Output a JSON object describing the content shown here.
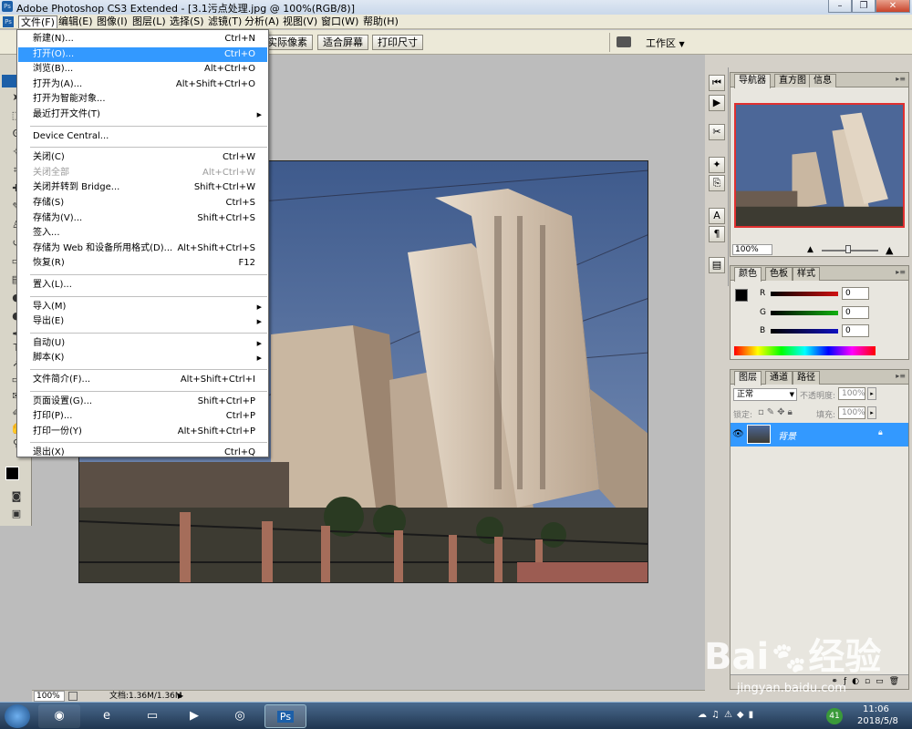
{
  "window": {
    "title": "Adobe Photoshop CS3 Extended - [3.1污点处理.jpg @ 100%(RGB/8)]",
    "app_icon": "Ps",
    "controls": [
      "minimize-icon",
      "restore-icon",
      "close-icon"
    ]
  },
  "menubar": {
    "items": [
      {
        "label": "文件(F)",
        "active": true
      },
      {
        "label": "编辑(E)"
      },
      {
        "label": "图像(I)"
      },
      {
        "label": "图层(L)"
      },
      {
        "label": "选择(S)"
      },
      {
        "label": "滤镜(T)"
      },
      {
        "label": "分析(A)"
      },
      {
        "label": "视图(V)"
      },
      {
        "label": "窗口(W)"
      },
      {
        "label": "帮助(H)"
      }
    ]
  },
  "options_bar": {
    "buttons": [
      "实际像素",
      "适合屏幕",
      "打印尺寸"
    ],
    "workspace": "工作区"
  },
  "file_menu": {
    "items": [
      {
        "label": "新建(N)...",
        "shortcut": "Ctrl+N"
      },
      {
        "label": "打开(O)...",
        "shortcut": "Ctrl+O",
        "highlighted": true
      },
      {
        "label": "浏览(B)...",
        "shortcut": "Alt+Ctrl+O"
      },
      {
        "label": "打开为(A)...",
        "shortcut": "Alt+Shift+Ctrl+O"
      },
      {
        "label": "打开为智能对象..."
      },
      {
        "label": "最近打开文件(T)",
        "submenu": true
      },
      {
        "separator": true
      },
      {
        "label": "Device Central..."
      },
      {
        "separator": true
      },
      {
        "label": "关闭(C)",
        "shortcut": "Ctrl+W"
      },
      {
        "label": "关闭全部",
        "shortcut": "Alt+Ctrl+W",
        "disabled": true
      },
      {
        "label": "关闭并转到 Bridge...",
        "shortcut": "Shift+Ctrl+W"
      },
      {
        "label": "存储(S)",
        "shortcut": "Ctrl+S"
      },
      {
        "label": "存储为(V)...",
        "shortcut": "Shift+Ctrl+S"
      },
      {
        "label": "签入..."
      },
      {
        "label": "存储为 Web 和设备所用格式(D)...",
        "shortcut": "Alt+Shift+Ctrl+S"
      },
      {
        "label": "恢复(R)",
        "shortcut": "F12"
      },
      {
        "separator": true
      },
      {
        "label": "置入(L)..."
      },
      {
        "separator": true
      },
      {
        "label": "导入(M)",
        "submenu": true
      },
      {
        "label": "导出(E)",
        "submenu": true
      },
      {
        "separator": true
      },
      {
        "label": "自动(U)",
        "submenu": true
      },
      {
        "label": "脚本(K)",
        "submenu": true
      },
      {
        "separator": true
      },
      {
        "label": "文件简介(F)...",
        "shortcut": "Alt+Shift+Ctrl+I"
      },
      {
        "separator": true
      },
      {
        "label": "页面设置(G)...",
        "shortcut": "Shift+Ctrl+P"
      },
      {
        "label": "打印(P)...",
        "shortcut": "Ctrl+P"
      },
      {
        "label": "打印一份(Y)",
        "shortcut": "Alt+Shift+Ctrl+P"
      },
      {
        "separator": true
      },
      {
        "label": "退出(X)",
        "shortcut": "Ctrl+Q"
      }
    ]
  },
  "status_bar": {
    "zoom": "100%",
    "doc_info": "文档:1.36M/1.36M"
  },
  "navigator_panel": {
    "tabs": [
      "导航器",
      "直方图",
      "信息"
    ],
    "zoom": "100%"
  },
  "color_panel": {
    "tabs": [
      "颜色",
      "色板",
      "样式"
    ],
    "channels": [
      {
        "label": "R",
        "value": "0",
        "color": "#d01010"
      },
      {
        "label": "G",
        "value": "0",
        "color": "#10a010"
      },
      {
        "label": "B",
        "value": "0",
        "color": "#1010c0"
      }
    ]
  },
  "layers_panel": {
    "tabs": [
      "图层",
      "通道",
      "路径"
    ],
    "blend_mode": "正常",
    "opacity_label": "不透明度:",
    "opacity": "100%",
    "lock_label": "锁定:",
    "fill_label": "填充:",
    "fill": "100%",
    "layers": [
      {
        "name": "背景",
        "selected": true,
        "visible": true,
        "locked": true
      }
    ]
  },
  "taskbar": {
    "time": "11:06",
    "date": "2018/5/8",
    "badge": "41",
    "ps_label": "Ps"
  },
  "watermark": {
    "brand": "Bai",
    "brand_cn": "经验",
    "url": "jingyan.baidu.com"
  },
  "colors": {
    "menu_highlight": "#3399ff",
    "layer_selected": "#3399ff",
    "canvas_bg": "#bcbcbc"
  }
}
